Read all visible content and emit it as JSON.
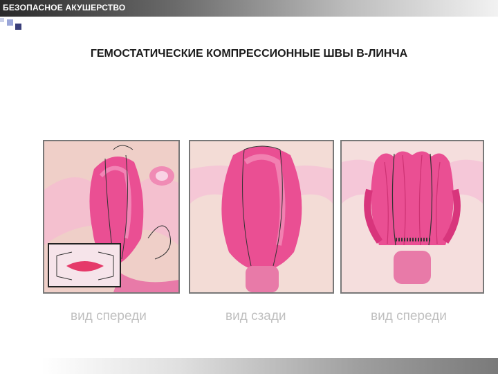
{
  "header": {
    "label": "БЕЗОПАСНОЕ АКУШЕРСТВО"
  },
  "slide": {
    "title": "ГЕМОСТАТИЧЕСКИЕ КОМПРЕССИОННЫЕ ШВЫ В-ЛИНЧА"
  },
  "figures": [
    {
      "caption": "вид спереди"
    },
    {
      "caption": "вид сзади"
    },
    {
      "caption": "вид спереди"
    }
  ],
  "colors": {
    "uterus": "#ea4f93",
    "tissue": "#f3dcd6",
    "suture": "#333333"
  }
}
